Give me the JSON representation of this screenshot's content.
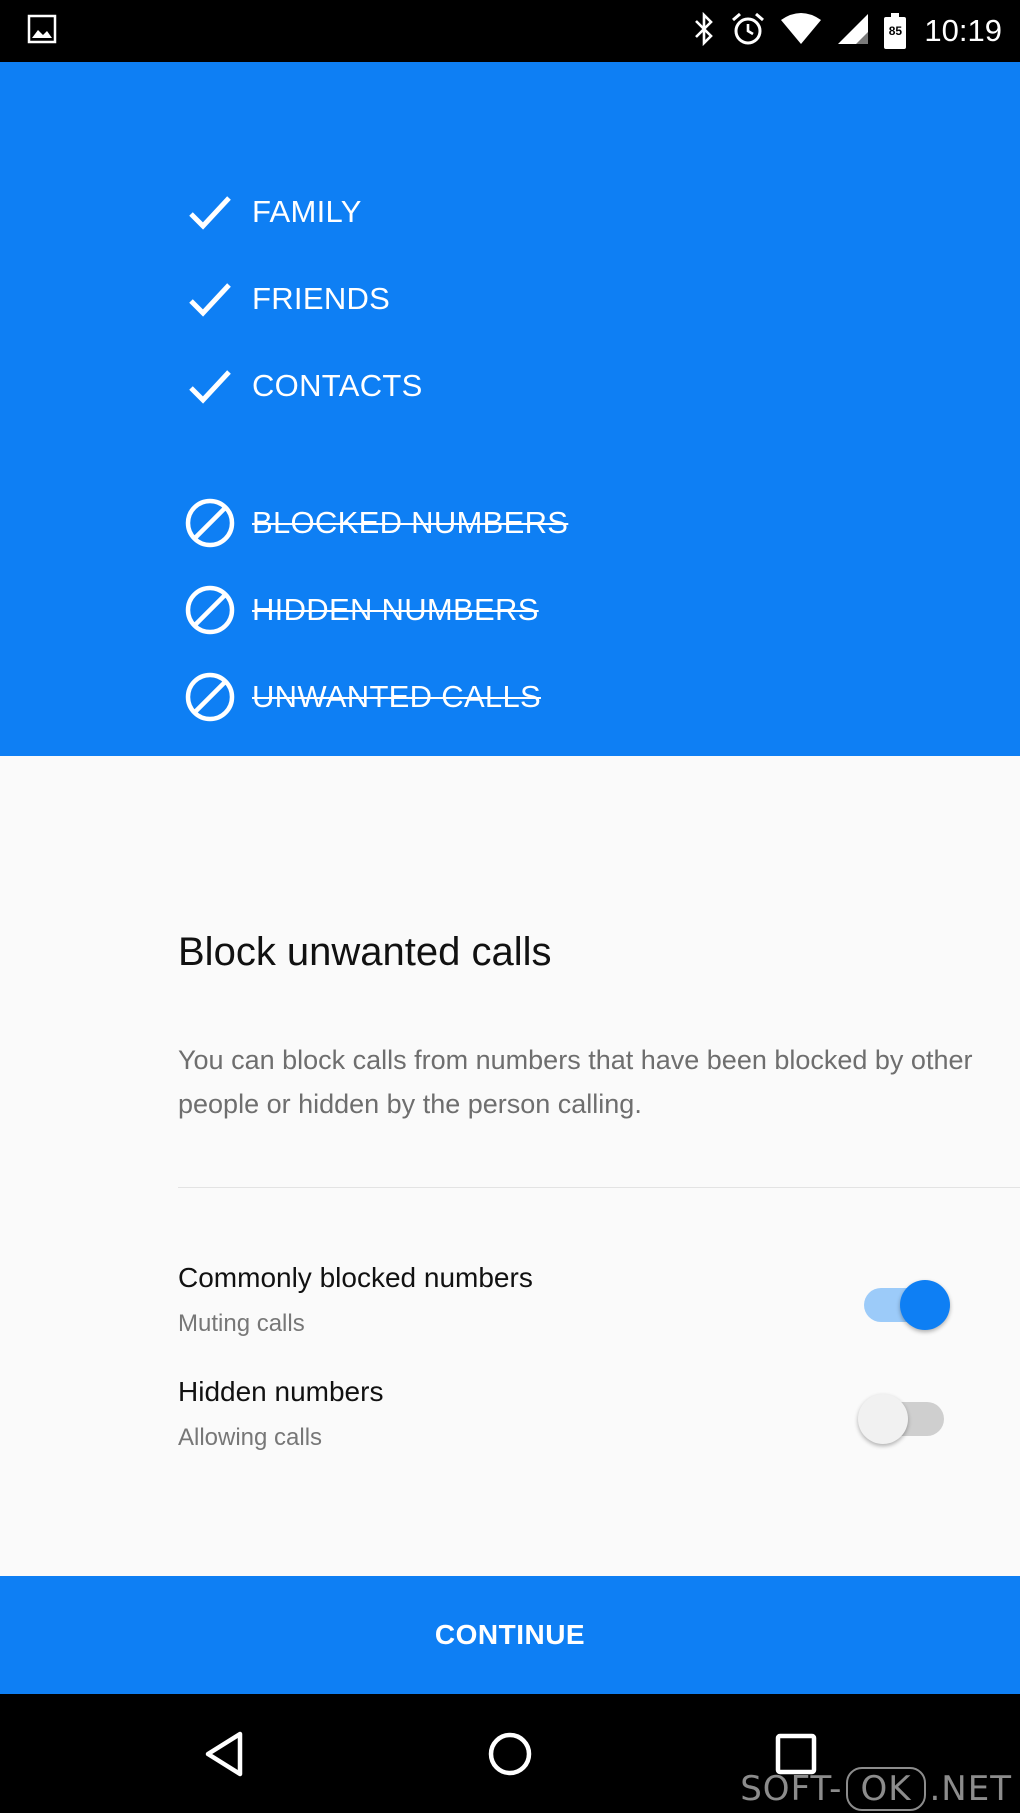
{
  "status_bar": {
    "time": "10:19",
    "battery_level": "85",
    "icons": [
      "gallery-icon",
      "bluetooth-icon",
      "alarm-icon",
      "wifi-icon",
      "signal-icon",
      "battery-icon"
    ]
  },
  "hero": {
    "allowed": [
      {
        "label": "FAMILY",
        "icon": "check-icon"
      },
      {
        "label": "FRIENDS",
        "icon": "check-icon"
      },
      {
        "label": "CONTACTS",
        "icon": "check-icon"
      }
    ],
    "blocked": [
      {
        "label": "BLOCKED NUMBERS",
        "icon": "block-icon"
      },
      {
        "label": "HIDDEN NUMBERS",
        "icon": "block-icon"
      },
      {
        "label": "UNWANTED CALLS",
        "icon": "block-icon"
      }
    ]
  },
  "card": {
    "title": "Block unwanted calls",
    "description": "You can block calls from numbers that have been blocked by other people or hidden by the person calling.",
    "settings": [
      {
        "title": "Commonly blocked numbers",
        "subtitle": "Muting calls",
        "enabled": true
      },
      {
        "title": "Hidden numbers",
        "subtitle": "Allowing calls",
        "enabled": false
      }
    ]
  },
  "continue_label": "CONTINUE",
  "navbar": {
    "icons": [
      "back-icon",
      "home-icon",
      "recents-icon"
    ]
  },
  "watermark": {
    "part1": "SOFT-",
    "part2": "OK",
    "part3": ".NET"
  },
  "colors": {
    "accent": "#0e7ff4",
    "toggle_track_on": "#9ccbf9"
  }
}
